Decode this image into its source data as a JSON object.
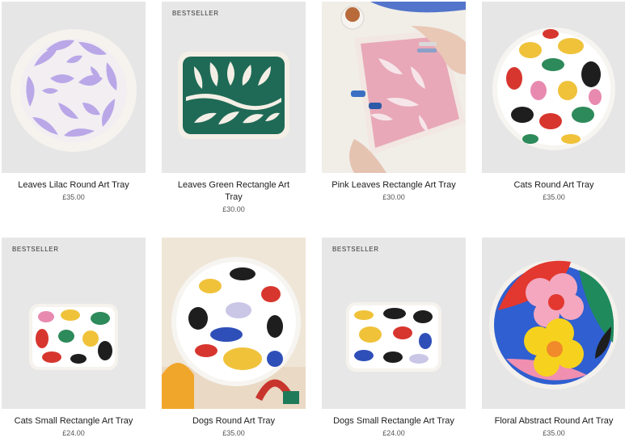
{
  "products": [
    {
      "title": "Leaves Lilac Round Art Tray",
      "price": "£35.00",
      "badge": "",
      "image_icon": "lilac-leaves-round-tray-image"
    },
    {
      "title": "Leaves Green Rectangle Art Tray",
      "price": "£30.00",
      "badge": "BESTSELLER",
      "image_icon": "green-leaves-rectangle-tray-image"
    },
    {
      "title": "Pink Leaves Rectangle Art Tray",
      "price": "£30.00",
      "badge": "",
      "image_icon": "pink-leaves-tray-painting-image"
    },
    {
      "title": "Cats Round Art Tray",
      "price": "£35.00",
      "badge": "",
      "image_icon": "cats-round-tray-image"
    },
    {
      "title": "Cats Small Rectangle Art Tray",
      "price": "£24.00",
      "badge": "BESTSELLER",
      "image_icon": "cats-small-rectangle-tray-image"
    },
    {
      "title": "Dogs Round Art Tray",
      "price": "£35.00",
      "badge": "",
      "image_icon": "dogs-round-tray-image"
    },
    {
      "title": "Dogs Small Rectangle Art Tray",
      "price": "£24.00",
      "badge": "BESTSELLER",
      "image_icon": "dogs-small-rectangle-tray-image"
    },
    {
      "title": "Floral Abstract Round Art Tray",
      "price": "£35.00",
      "badge": "",
      "image_icon": "floral-abstract-round-tray-image"
    }
  ]
}
